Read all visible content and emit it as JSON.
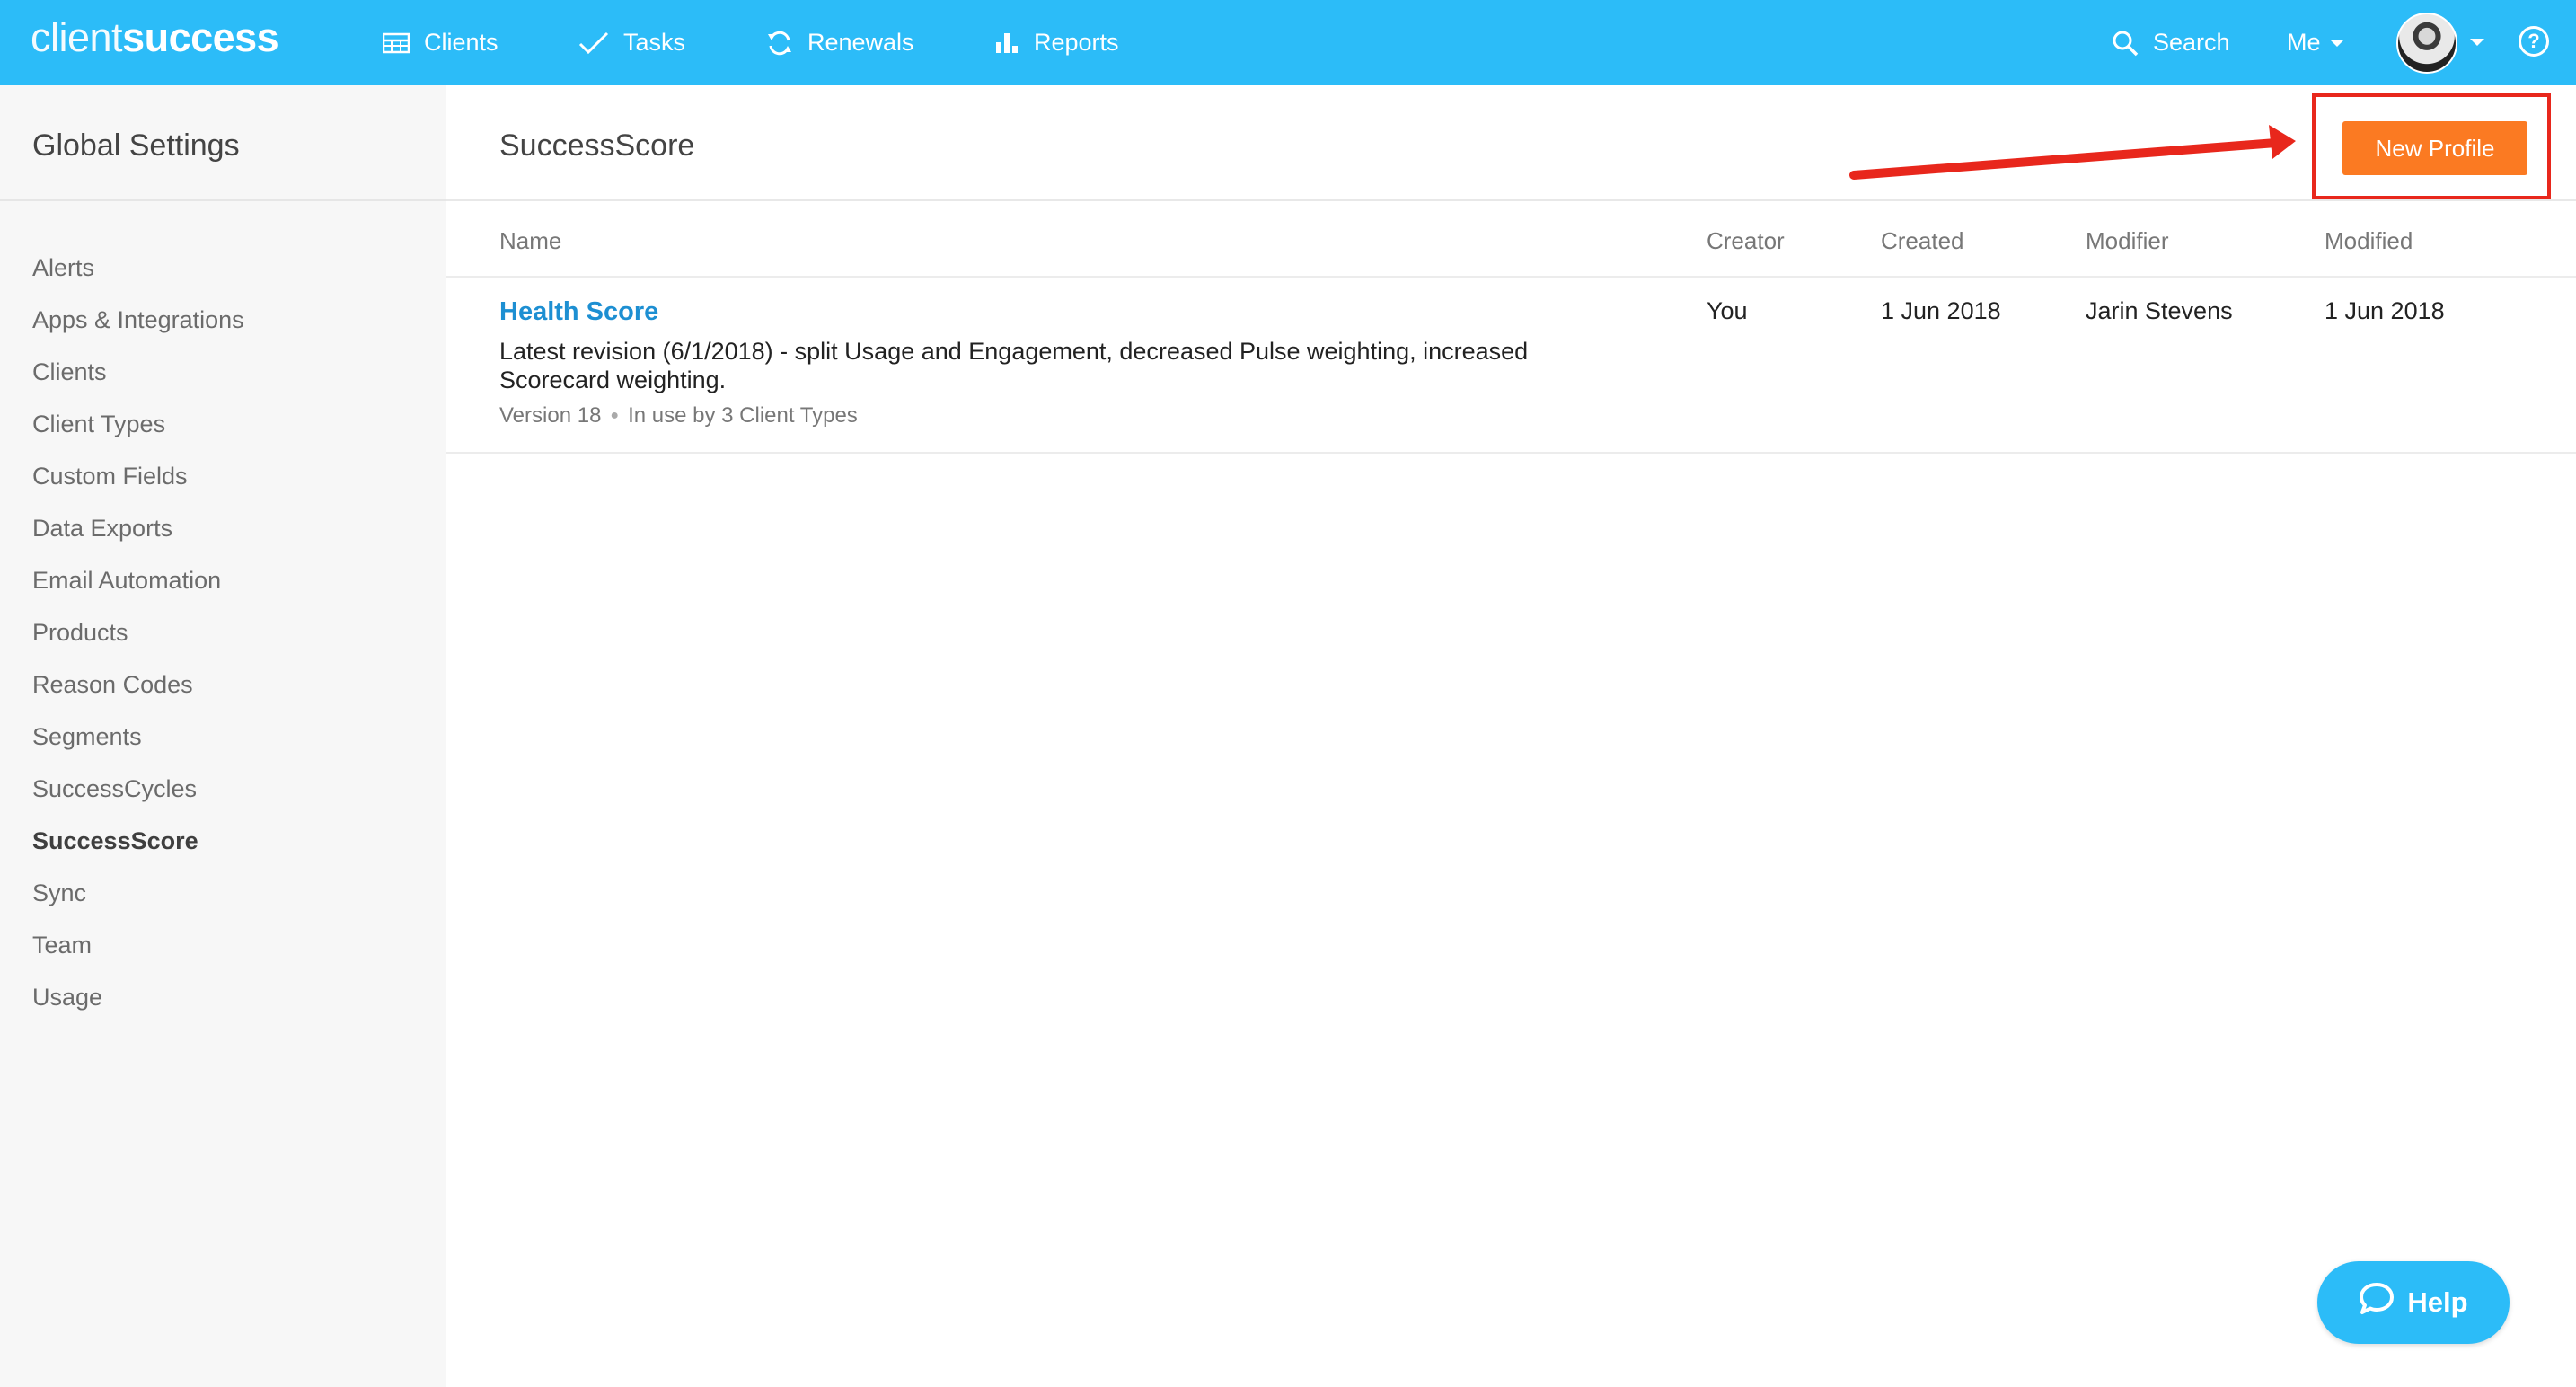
{
  "brand": {
    "logo_light": "client",
    "logo_bold": "success"
  },
  "nav": {
    "clients": "Clients",
    "tasks": "Tasks",
    "renewals": "Renewals",
    "reports": "Reports",
    "search": "Search",
    "me": "Me",
    "help_glyph": "?"
  },
  "sidebar": {
    "title": "Global Settings",
    "items": [
      "Alerts",
      "Apps & Integrations",
      "Clients",
      "Client Types",
      "Custom Fields",
      "Data Exports",
      "Email Automation",
      "Products",
      "Reason Codes",
      "Segments",
      "SuccessCycles",
      "SuccessScore",
      "Sync",
      "Team",
      "Usage"
    ],
    "active": "SuccessScore"
  },
  "page": {
    "title": "SuccessScore",
    "new_profile_label": "New Profile"
  },
  "table": {
    "columns": {
      "name": "Name",
      "creator": "Creator",
      "created": "Created",
      "modifier": "Modifier",
      "modified": "Modified"
    },
    "rows": [
      {
        "name": "Health Score",
        "description": "Latest revision (6/1/2018) - split Usage and Engagement, decreased Pulse weighting, increased Scorecard weighting.",
        "version": "Version 18",
        "usage": "In use by 3 Client Types",
        "creator": "You",
        "created": "1 Jun 2018",
        "modifier": "Jarin Stevens",
        "modified": "1 Jun 2018"
      }
    ]
  },
  "help_widget": {
    "label": "Help"
  },
  "colors": {
    "topbar": "#2cbcf8",
    "accent_orange": "#fb7a22",
    "annotation_red": "#e8271c",
    "link_blue": "#1d8fd2"
  },
  "icons": [
    "clients-table-icon",
    "tasks-check-icon",
    "renewals-refresh-icon",
    "reports-bar-icon",
    "search-icon",
    "caret-down-icon",
    "help-circle-icon",
    "chat-bubble-icon"
  ]
}
